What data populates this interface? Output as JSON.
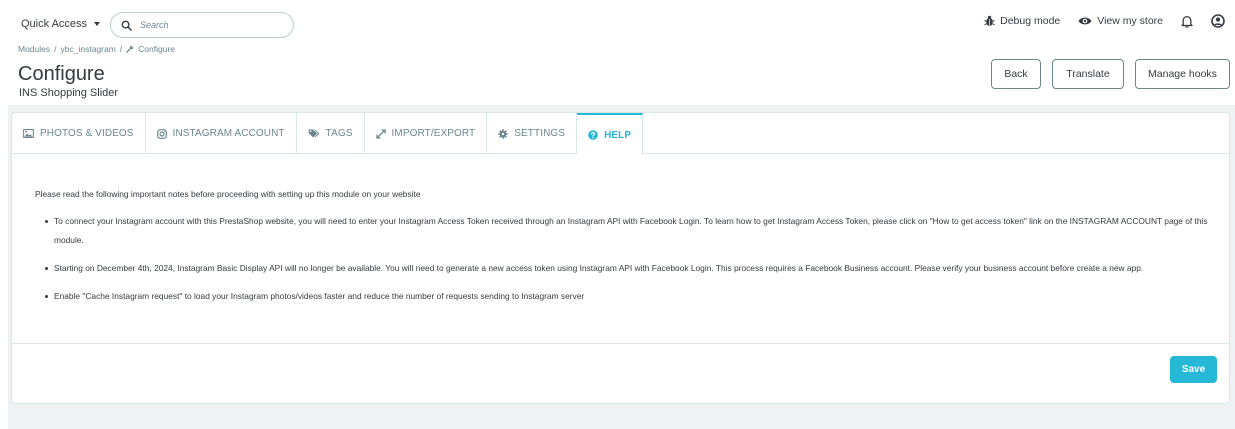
{
  "topbar": {
    "quick_access_label": "Quick Access",
    "search_placeholder": "Search",
    "debug_mode_label": "Debug mode",
    "view_store_label": "View my store"
  },
  "breadcrumb": {
    "items": [
      "Modules",
      "ybc_instagram",
      "Configure"
    ]
  },
  "page": {
    "title": "Configure",
    "subtitle": "INS Shopping Slider"
  },
  "toolbar": {
    "back_label": "Back",
    "translate_label": "Translate",
    "manage_hooks_label": "Manage hooks"
  },
  "tabs": [
    {
      "label": "PHOTOS & VIDEOS",
      "icon": "image-icon",
      "active": false
    },
    {
      "label": "INSTAGRAM ACCOUNT",
      "icon": "instagram-icon",
      "active": false
    },
    {
      "label": "TAGS",
      "icon": "tags-icon",
      "active": false
    },
    {
      "label": "IMPORT/EXPORT",
      "icon": "exchange-icon",
      "active": false
    },
    {
      "label": "SETTINGS",
      "icon": "gear-icon",
      "active": false
    },
    {
      "label": "HELP",
      "icon": "question-icon",
      "active": true
    }
  ],
  "help": {
    "intro": "Please read the following important notes before proceeding with setting up this module on your website",
    "notes": [
      "To connect your Instagram account with this PrestaShop website, you will need to enter your Instagram Access Token received through an Instagram API with Facebook Login. To learn how to get Instagram Access Token, please click on \"How to get access token\" link on the INSTAGRAM ACCOUNT page of this module.",
      "Starting on December 4th, 2024, Instagram Basic Display API will no longer be available. You will need to generate a new access token using Instagram API with Facebook Login. This process requires a Facebook Business account. Please verify your business account before create a new app.",
      "Enable \"Cache Instagram request\" to load your Instagram photos/videos faster and reduce the number of requests sending to Instagram server"
    ]
  },
  "footer": {
    "save_label": "Save"
  },
  "colors": {
    "accent": "#25b9d7",
    "text": "#363a41",
    "muted": "#6c868e",
    "background": "#eff1f2",
    "border": "#dbe6e9"
  }
}
